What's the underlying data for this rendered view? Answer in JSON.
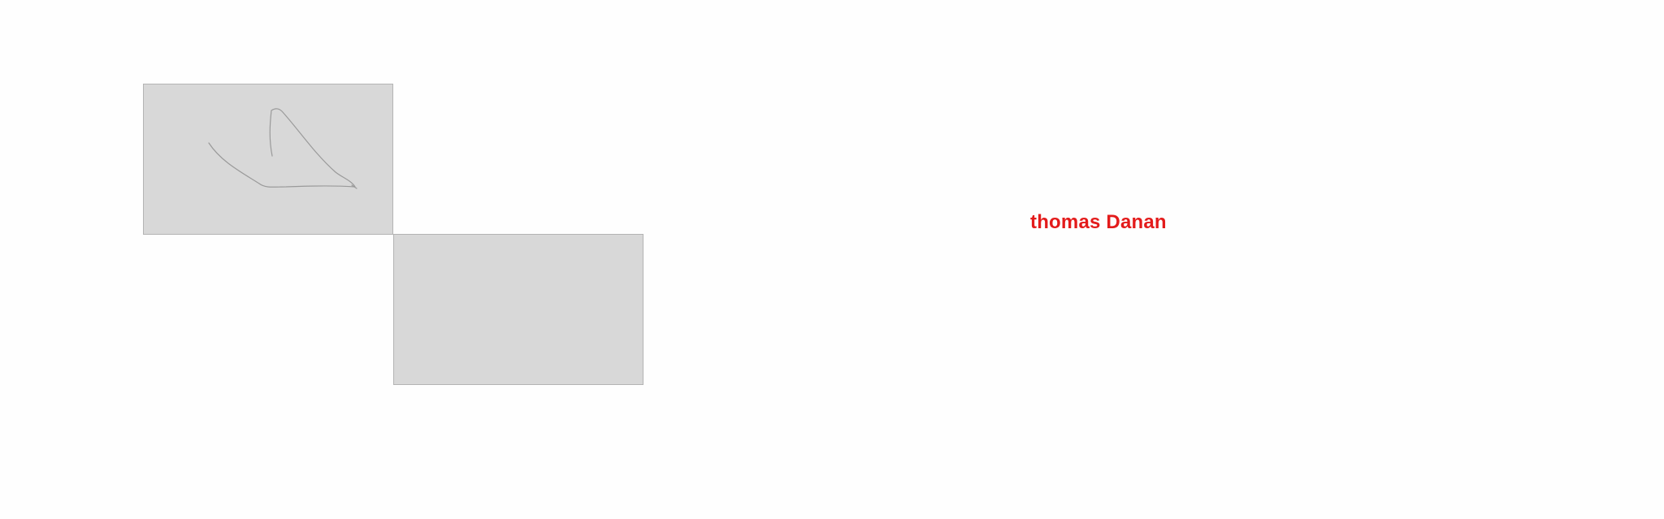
{
  "name_label": {
    "text": "thomas Danan",
    "color": "#e31b1b"
  },
  "panels": [
    {
      "id": "panel-top-left",
      "has_drawing": true
    },
    {
      "id": "panel-bottom-right",
      "has_drawing": false
    }
  ],
  "colors": {
    "background": "#fefefe",
    "panel_fill": "#d8d8d8",
    "panel_border": "#b4b4b4",
    "stroke": "#9a9a9a"
  }
}
